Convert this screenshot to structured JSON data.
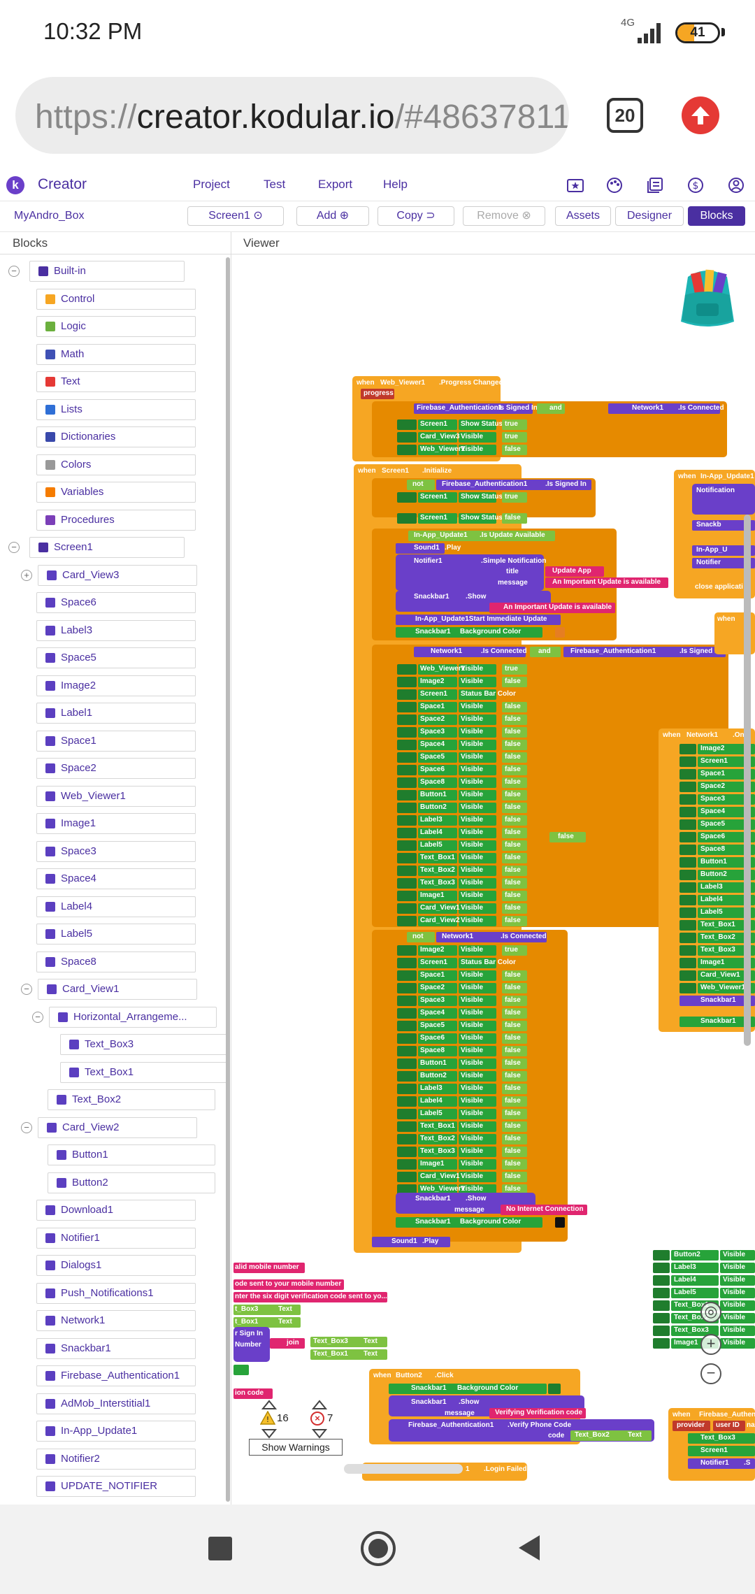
{
  "status": {
    "time": "10:32 PM",
    "network": "4G",
    "battery": "41",
    "battery_level": 0.41
  },
  "browser": {
    "url_prefix": "https://",
    "url_host": "creator.kodular.io",
    "url_path": "/#48637811",
    "tab_count": "20"
  },
  "app": {
    "logo": "k",
    "title": "Creator",
    "menu": [
      "Project",
      "Test",
      "Export",
      "Help"
    ],
    "icons": [
      "folder-star-icon",
      "palette-icon",
      "library-icon",
      "dollar-icon",
      "account-icon"
    ]
  },
  "toolbar": {
    "project": "MyAndro_Box",
    "screen": "Screen1",
    "add": "Add",
    "copy": "Copy",
    "remove": "Remove",
    "assets": "Assets",
    "designer": "Designer",
    "blocks": "Blocks"
  },
  "panels": {
    "blocks": "Blocks",
    "viewer": "Viewer"
  },
  "builtin": {
    "label": "Built-in",
    "items": [
      {
        "label": "Control",
        "color": "#f6a623"
      },
      {
        "label": "Logic",
        "color": "#6bb03e"
      },
      {
        "label": "Math",
        "color": "#3f51b5"
      },
      {
        "label": "Text",
        "color": "#e53935"
      },
      {
        "label": "Lists",
        "color": "#2f6fd6"
      },
      {
        "label": "Dictionaries",
        "color": "#3949ab"
      },
      {
        "label": "Colors",
        "color": "#999999"
      },
      {
        "label": "Variables",
        "color": "#f57c00"
      },
      {
        "label": "Procedures",
        "color": "#7b3fb8"
      }
    ]
  },
  "components": {
    "screen": "Screen1",
    "items": [
      {
        "label": "Card_View3",
        "indent": 1,
        "toggle": "+"
      },
      {
        "label": "Space6",
        "indent": 1
      },
      {
        "label": "Label3",
        "indent": 1
      },
      {
        "label": "Space5",
        "indent": 1
      },
      {
        "label": "Image2",
        "indent": 1
      },
      {
        "label": "Label1",
        "indent": 1
      },
      {
        "label": "Space1",
        "indent": 1
      },
      {
        "label": "Space2",
        "indent": 1
      },
      {
        "label": "Web_Viewer1",
        "indent": 1
      },
      {
        "label": "Image1",
        "indent": 1
      },
      {
        "label": "Space3",
        "indent": 1
      },
      {
        "label": "Space4",
        "indent": 1
      },
      {
        "label": "Label4",
        "indent": 1
      },
      {
        "label": "Label5",
        "indent": 1
      },
      {
        "label": "Space8",
        "indent": 1
      },
      {
        "label": "Card_View1",
        "indent": 1,
        "toggle": "−"
      },
      {
        "label": "Horizontal_Arrangeme...",
        "indent": 2,
        "toggle": "−"
      },
      {
        "label": "Text_Box3",
        "indent": 3
      },
      {
        "label": "Text_Box1",
        "indent": 3
      },
      {
        "label": "Text_Box2",
        "indent": 2
      },
      {
        "label": "Card_View2",
        "indent": 1,
        "toggle": "−"
      },
      {
        "label": "Button1",
        "indent": 2
      },
      {
        "label": "Button2",
        "indent": 2
      },
      {
        "label": "Download1",
        "indent": 1
      },
      {
        "label": "Notifier1",
        "indent": 1
      },
      {
        "label": "Dialogs1",
        "indent": 1
      },
      {
        "label": "Push_Notifications1",
        "indent": 1
      },
      {
        "label": "Network1",
        "indent": 1
      },
      {
        "label": "Snackbar1",
        "indent": 1
      },
      {
        "label": "Firebase_Authentication1",
        "indent": 1
      },
      {
        "label": "AdMob_Interstitial1",
        "indent": 1
      },
      {
        "label": "In-App_Update1",
        "indent": 1
      },
      {
        "label": "Notifier2",
        "indent": 1
      },
      {
        "label": "UPDATE_NOTIFIER",
        "indent": 1
      }
    ]
  },
  "blocks": {
    "ev1": {
      "when": "when",
      "comp": "Web_Viewer1",
      "event": ".Progress Changed",
      "param": "progress"
    },
    "ev1_if": {
      "call1": "Firebase_Authentication1",
      "prop1": ".Is Signed In",
      "and": "and",
      "call2": "Network1",
      "prop2": ".Is Connected"
    },
    "ev1_then": [
      {
        "comp": "Screen1",
        "prop": "Show Status Bar",
        "val": "true"
      },
      {
        "comp": "Card_View3",
        "prop": "Visible",
        "val": "true"
      },
      {
        "comp": "Web_Viewer1",
        "prop": "Visible",
        "val": "false"
      }
    ],
    "ev2": {
      "when": "when",
      "comp": "Screen1",
      "event": ".Initialize"
    },
    "ev2_if1": {
      "not": "not",
      "call": "Firebase_Authentication1",
      "prop": ".Is Signed In"
    },
    "ev2_if1_then": {
      "comp": "Screen1",
      "prop": "Show Status Bar",
      "val": "true"
    },
    "ev2_if1_else": {
      "comp": "Screen1",
      "prop": "Show Status Bar",
      "val": "false"
    },
    "ev2_if2": {
      "comp": "In-App_Update1",
      "prop": ".Is Update Available"
    },
    "ev2_if2_then": {
      "sound": "Sound1",
      "play": ".Play",
      "notifier": "Notifier1",
      "notify": ".Simple Notification",
      "title_key": "title",
      "title": "Update App",
      "message_key": "message",
      "message": "An Important Update is available",
      "snackbar": "Snackbar1",
      "show": ".Show",
      "snack_msg": "An Important Update is available",
      "update": "In-App_Update1",
      "start": ".Start Immediate Update",
      "bg_comp": "Snackbar1",
      "bg_prop": "Background Color"
    },
    "ev2_if3": {
      "call1": "Network1",
      "prop1": ".Is Connected",
      "and": "and",
      "call2": "Firebase_Authentication1",
      "prop2": ".Is Signed In"
    },
    "ev2_if3_then": [
      {
        "comp": "Web_Viewer1",
        "prop": "Visible",
        "val": "true"
      },
      {
        "comp": "Image2",
        "prop": "Visible",
        "val": "false"
      },
      {
        "comp": "Screen1",
        "prop": "Status Bar Color",
        "val": ""
      },
      {
        "comp": "Space1",
        "prop": "Visible",
        "val": "false"
      },
      {
        "comp": "Space2",
        "prop": "Visible",
        "val": "false"
      },
      {
        "comp": "Space3",
        "prop": "Visible",
        "val": "false"
      },
      {
        "comp": "Space4",
        "prop": "Visible",
        "val": "false"
      },
      {
        "comp": "Space5",
        "prop": "Visible",
        "val": "false"
      },
      {
        "comp": "Space6",
        "prop": "Visible",
        "val": "false"
      },
      {
        "comp": "Space8",
        "prop": "Visible",
        "val": "false"
      },
      {
        "comp": "Button1",
        "prop": "Visible",
        "val": "false"
      },
      {
        "comp": "Button2",
        "prop": "Visible",
        "val": "false"
      },
      {
        "comp": "Label3",
        "prop": "Visible",
        "val": "false"
      },
      {
        "comp": "Label4",
        "prop": "Visible",
        "val": "false"
      },
      {
        "comp": "Label5",
        "prop": "Visible",
        "val": "false"
      },
      {
        "comp": "Text_Box1",
        "prop": "Visible",
        "val": "false"
      },
      {
        "comp": "Text_Box2",
        "prop": "Visible",
        "val": "false"
      },
      {
        "comp": "Text_Box3",
        "prop": "Visible",
        "val": "false"
      },
      {
        "comp": "Image1",
        "prop": "Visible",
        "val": "false"
      },
      {
        "comp": "Card_View1",
        "prop": "Visible",
        "val": "false"
      },
      {
        "comp": "Card_View2",
        "prop": "Visible",
        "val": "false"
      }
    ],
    "loose_false": "false",
    "ev2_if4": {
      "not": "not",
      "call": "Network1",
      "prop": ".Is Connected"
    },
    "ev2_if4_then": [
      {
        "comp": "Image2",
        "prop": "Visible",
        "val": "true"
      },
      {
        "comp": "Screen1",
        "prop": "Status Bar Color",
        "val": ""
      },
      {
        "comp": "Space1",
        "prop": "Visible",
        "val": "false"
      },
      {
        "comp": "Space2",
        "prop": "Visible",
        "val": "false"
      },
      {
        "comp": "Space3",
        "prop": "Visible",
        "val": "false"
      },
      {
        "comp": "Space4",
        "prop": "Visible",
        "val": "false"
      },
      {
        "comp": "Space5",
        "prop": "Visible",
        "val": "false"
      },
      {
        "comp": "Space6",
        "prop": "Visible",
        "val": "false"
      },
      {
        "comp": "Space8",
        "prop": "Visible",
        "val": "false"
      },
      {
        "comp": "Button1",
        "prop": "Visible",
        "val": "false"
      },
      {
        "comp": "Button2",
        "prop": "Visible",
        "val": "false"
      },
      {
        "comp": "Label3",
        "prop": "Visible",
        "val": "false"
      },
      {
        "comp": "Label4",
        "prop": "Visible",
        "val": "false"
      },
      {
        "comp": "Label5",
        "prop": "Visible",
        "val": "false"
      },
      {
        "comp": "Text_Box1",
        "prop": "Visible",
        "val": "false"
      },
      {
        "comp": "Text_Box2",
        "prop": "Visible",
        "val": "false"
      },
      {
        "comp": "Text_Box3",
        "prop": "Visible",
        "val": "false"
      },
      {
        "comp": "Image1",
        "prop": "Visible",
        "val": "false"
      },
      {
        "comp": "Card_View1",
        "prop": "Visible",
        "val": "false"
      },
      {
        "comp": "Web_Viewer1",
        "prop": "Visible",
        "val": "false"
      }
    ],
    "ev2_if4_snack": {
      "snackbar": "Snackbar1",
      "show": ".Show",
      "message_key": "message",
      "message": "No Internet Connection",
      "bg_comp": "Snackbar1",
      "bg_prop": "Background Color"
    },
    "ev2_end": {
      "sound": "Sound1",
      "play": ".Play"
    },
    "right_upd": {
      "when": "when",
      "comp": "In-App_Update1",
      "call1": "Notification",
      "call2": "Snackb",
      "call3": "In-App_U",
      "call4": "Notifier",
      "close": "close applicati"
    },
    "right_net": {
      "when": "when",
      "comp": "Network1",
      "event": ".On",
      "rows": [
        "Image2",
        "Screen1",
        "Space1",
        "Space2",
        "Space3",
        "Space4",
        "Space5",
        "Space6",
        "Space8",
        "Button1",
        "Button2",
        "Label3",
        "Label4",
        "Label5",
        "Text_Box1",
        "Text_Box2",
        "Text_Box3",
        "Image1",
        "Card_View1",
        "Web_Viewer1"
      ],
      "snack1": "Snackbar1",
      "snack2": "Snackbar1"
    },
    "right_when2": "when",
    "bottom_texts": [
      "alid mobile number",
      "ode sent to your mobile number",
      "nter the six digit verification code sent to yo...",
      "ion code"
    ],
    "bottom_sets": [
      {
        "comp": "t_Box3",
        "prop": "Text"
      },
      {
        "comp": "t_Box1",
        "prop": "Text"
      }
    ],
    "bottom_signin": "r Sign In",
    "bottom_number": "Number",
    "bottom_join": {
      "join": "join",
      "a": "Text_Box3",
      "a_prop": "Text",
      "b": "Text_Box1",
      "b_prop": "Text"
    },
    "btn2click": {
      "when": "when",
      "comp": "Button2",
      "event": ".Click",
      "snack1": "Snackbar1",
      "bg": "Background Color",
      "snack2": "Snackbar1",
      "show": ".Show",
      "message_key": "message",
      "message": "Verifying Verification code",
      "fa": "Firebase_Authentication1",
      "verify": ".Verify Phone Code",
      "code_key": "code",
      "tb": "Text_Box2",
      "tb_prop": "Text"
    },
    "loginfailed": {
      "comp": "1",
      "event": ".Login Failed"
    },
    "right_bottom": [
      {
        "comp": "Button2",
        "prop": "Visible"
      },
      {
        "comp": "Label3",
        "prop": "Visible"
      },
      {
        "comp": "Label4",
        "prop": "Visible"
      },
      {
        "comp": "Label5",
        "prop": "Visible"
      },
      {
        "comp": "Text_Box1",
        "prop": "Visible"
      },
      {
        "comp": "Text_Box2",
        "prop": "Visible"
      },
      {
        "comp": "Text_Box3",
        "prop": "Visible"
      },
      {
        "comp": "Image1",
        "prop": "Visible"
      }
    ],
    "fa_auth": {
      "when": "when",
      "comp": "Firebase_Authent",
      "provider": "provider",
      "uid": "user ID",
      "na": "na",
      "set1": "Text_Box3",
      "set2": "Screen1",
      "call": "Notifier1",
      "s": ".S"
    }
  },
  "warnings": {
    "warn_count": "16",
    "error_count": "7",
    "button": "Show Warnings"
  },
  "colors": {
    "event": "#f6a623",
    "control": "#e68a00",
    "component": "#27a33a",
    "component_dark": "#1f7d2d",
    "method": "#6a3fc9",
    "logic": "#7ec241",
    "text": "#e0256f",
    "math": "#3c6ae8",
    "primary": "#4a2fa1"
  }
}
